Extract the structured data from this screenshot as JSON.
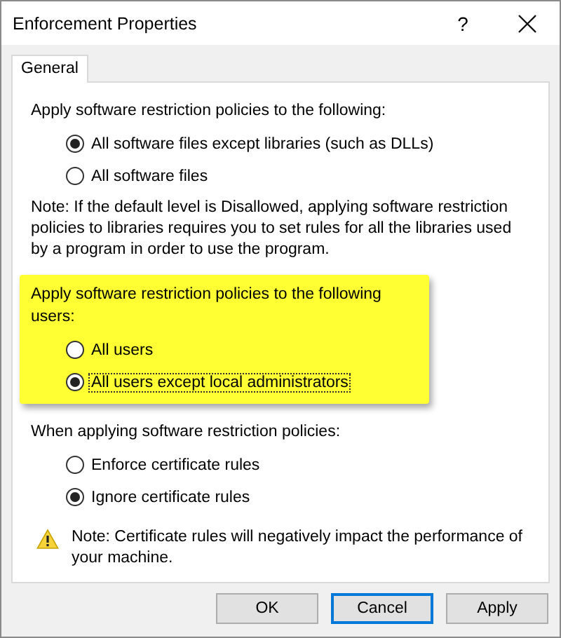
{
  "window": {
    "title": "Enforcement Properties",
    "help": "?"
  },
  "tabs": [
    {
      "label": "General",
      "selected": true
    }
  ],
  "groups": [
    {
      "heading": "Apply software restriction policies to the following:",
      "highlighted": false,
      "options": [
        {
          "label": "All software files except libraries (such as DLLs)",
          "selected": true,
          "focused": false
        },
        {
          "label": "All software files",
          "selected": false,
          "focused": false
        }
      ],
      "note": {
        "kind": "plain",
        "text": "Note:  If the default level is Disallowed, applying software restriction policies to libraries requires you to set rules for all the libraries used by a program in order to use the program."
      }
    },
    {
      "heading": "Apply software restriction policies to the following users:",
      "highlighted": true,
      "options": [
        {
          "label": "All users",
          "selected": false,
          "focused": false
        },
        {
          "label": "All users except local administrators",
          "selected": true,
          "focused": true
        }
      ]
    },
    {
      "heading": "When applying software restriction policies:",
      "highlighted": false,
      "options": [
        {
          "label": "Enforce certificate rules",
          "selected": false,
          "focused": false
        },
        {
          "label": "Ignore certificate rules",
          "selected": true,
          "focused": false
        }
      ],
      "note": {
        "kind": "warning",
        "text": "Note:  Certificate rules will negatively impact the performance of your machine."
      }
    }
  ],
  "buttons": [
    {
      "label": "OK",
      "default": false
    },
    {
      "label": "Cancel",
      "default": true
    },
    {
      "label": "Apply",
      "default": false
    }
  ]
}
